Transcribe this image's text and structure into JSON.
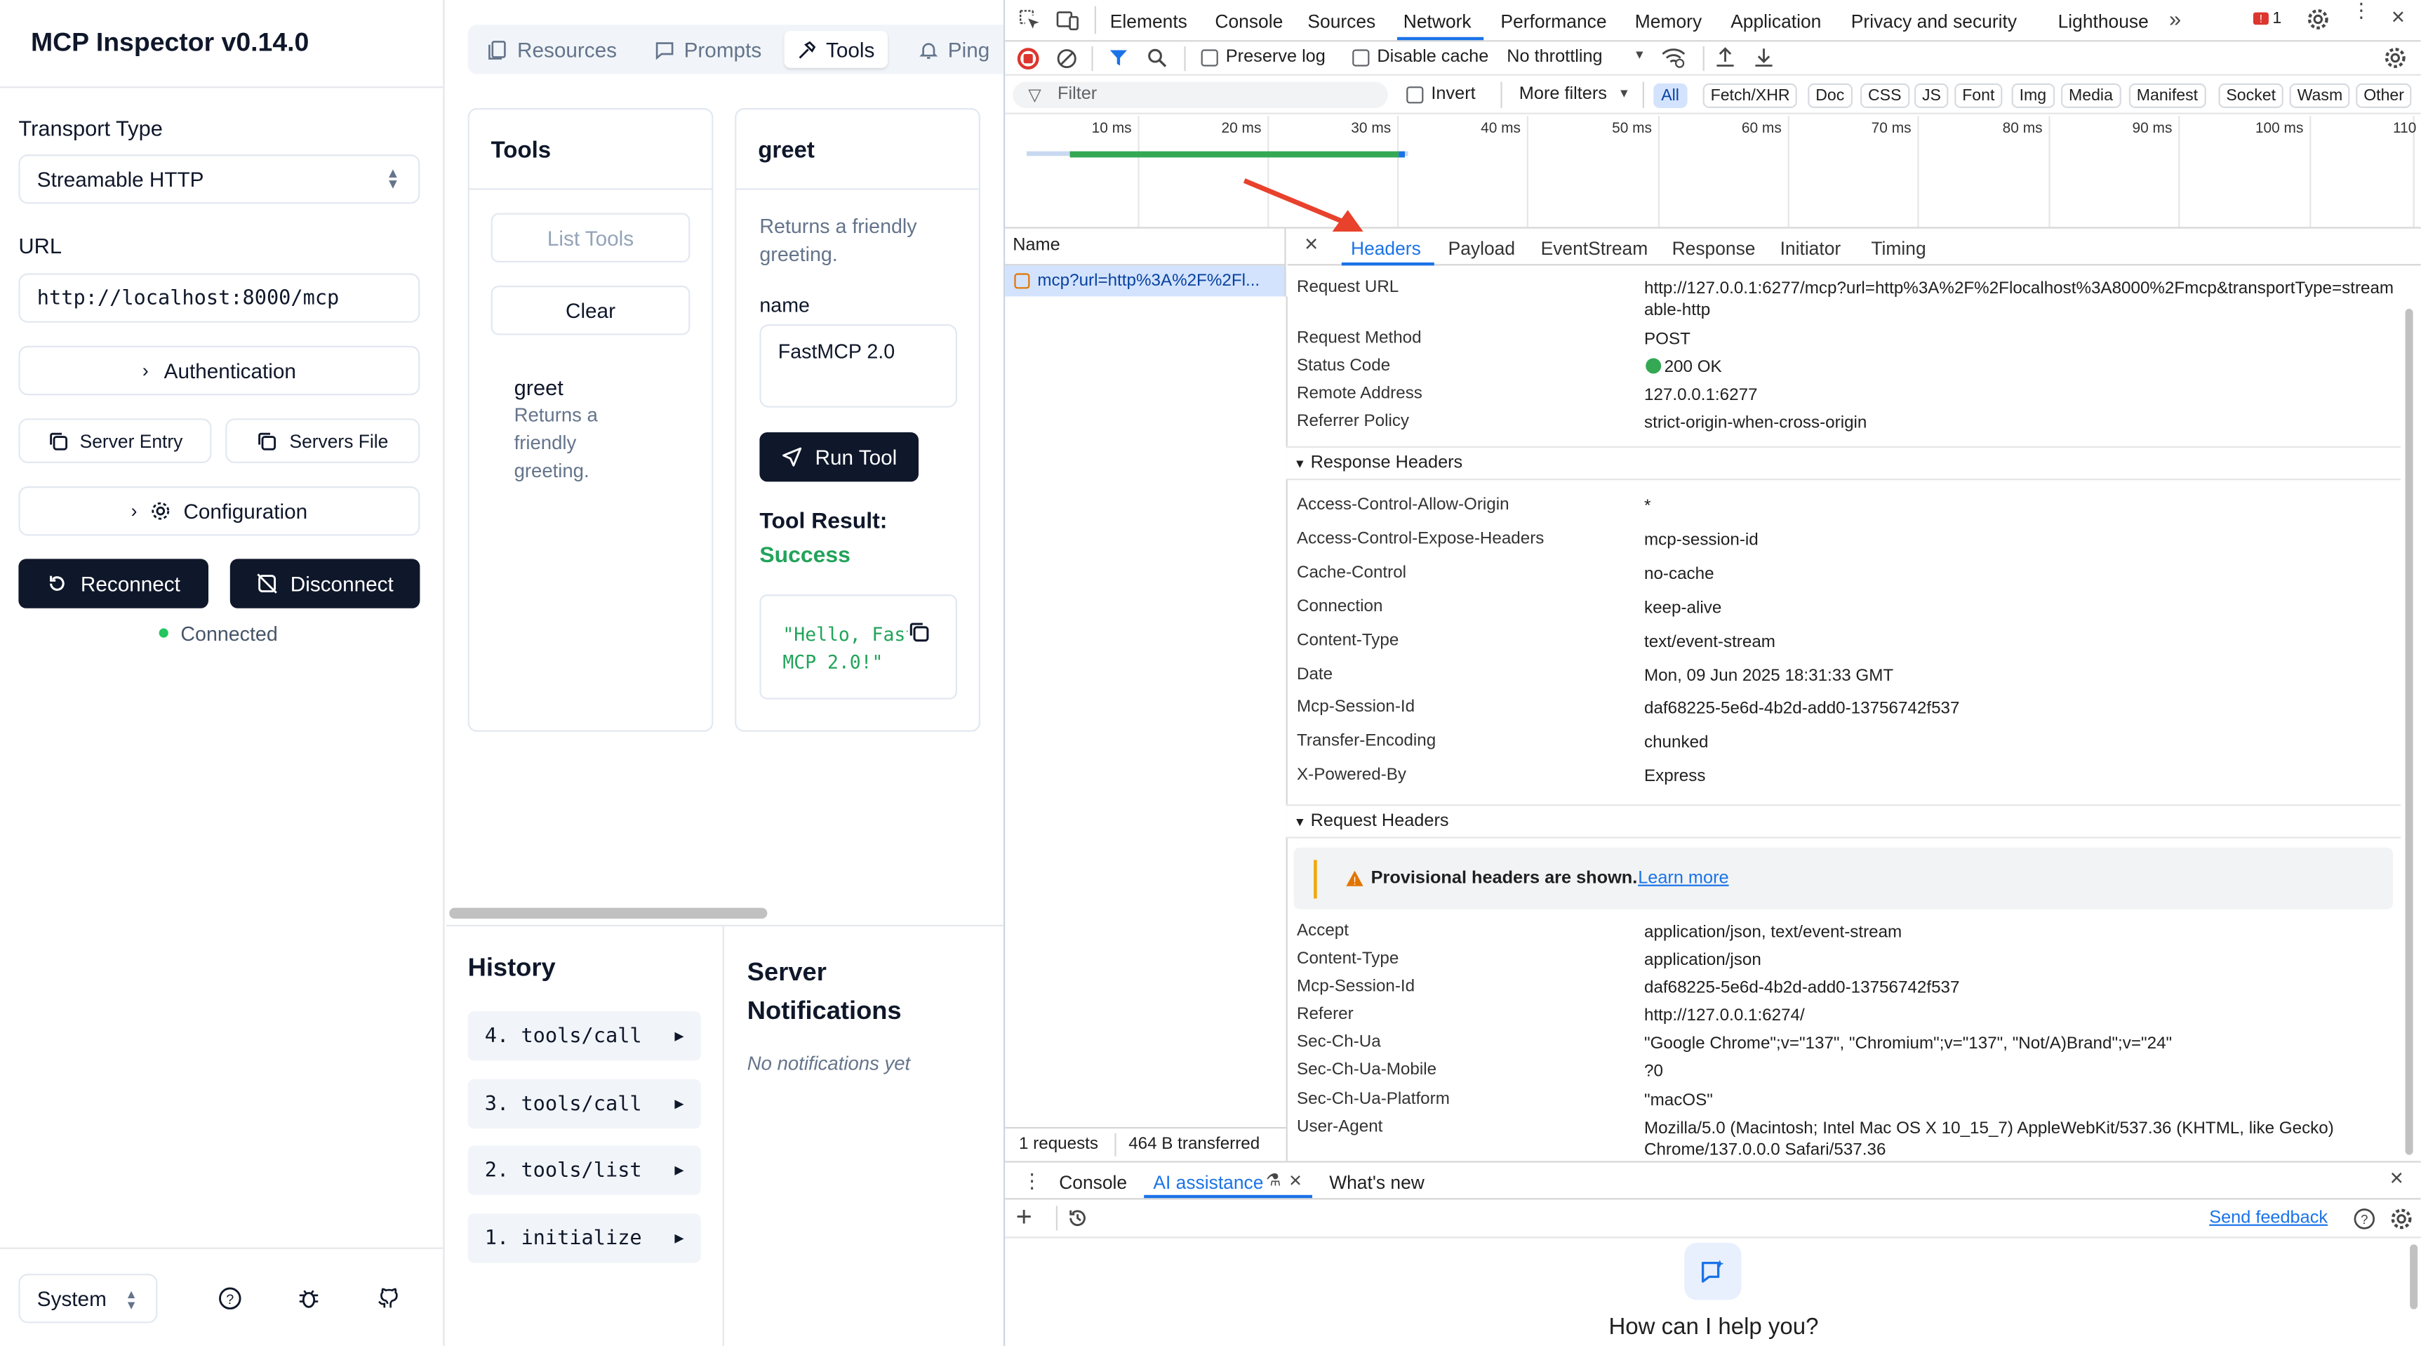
{
  "sidebar": {
    "title": "MCP Inspector v0.14.0",
    "transport_label": "Transport Type",
    "transport_value": "Streamable HTTP",
    "url_label": "URL",
    "url_value": "http://localhost:8000/mcp",
    "authentication": "Authentication",
    "server_entry": "Server Entry",
    "servers_file": "Servers File",
    "configuration": "Configuration",
    "reconnect": "Reconnect",
    "disconnect": "Disconnect",
    "status": "Connected",
    "theme": "System"
  },
  "main": {
    "tabs": [
      "Resources",
      "Prompts",
      "Tools",
      "Ping"
    ],
    "tools_card": {
      "title": "Tools",
      "list_tools": "List Tools",
      "clear": "Clear",
      "tool_name": "greet",
      "tool_desc": "Returns a friendly greeting."
    },
    "greet_card": {
      "title": "greet",
      "desc": "Returns a friendly greeting.",
      "param_label": "name",
      "param_value": "FastMCP 2.0",
      "run": "Run Tool",
      "result_label": "Tool Result:",
      "result_status": "Success",
      "result_text": "\"Hello, FastMCP 2.0!\""
    },
    "history": {
      "title": "History",
      "items": [
        "4. tools/call",
        "3. tools/call",
        "2. tools/list",
        "1. initialize"
      ]
    },
    "notifications": {
      "title": "Server Notifications",
      "empty": "No notifications yet"
    }
  },
  "devtools": {
    "tabs": [
      "Elements",
      "Console",
      "Sources",
      "Network",
      "Performance",
      "Memory",
      "Application",
      "Privacy and security",
      "Lighthouse"
    ],
    "active_tab": "Network",
    "issues_count": "1",
    "toolbar": {
      "preserve_log": "Preserve log",
      "disable_cache": "Disable cache",
      "throttling": "No throttling"
    },
    "filter_placeholder": "Filter",
    "invert": "Invert",
    "more_filters": "More filters",
    "type_filters": [
      "All",
      "Fetch/XHR",
      "Doc",
      "CSS",
      "JS",
      "Font",
      "Img",
      "Media",
      "Manifest",
      "Socket",
      "Wasm",
      "Other"
    ],
    "timeline_ticks": [
      "10 ms",
      "20 ms",
      "30 ms",
      "40 ms",
      "50 ms",
      "60 ms",
      "70 ms",
      "80 ms",
      "90 ms",
      "100 ms",
      "110"
    ],
    "name_header": "Name",
    "request_name": "mcp?url=http%3A%2F%2Fl...",
    "detail_tabs": [
      "Headers",
      "Payload",
      "EventStream",
      "Response",
      "Initiator",
      "Timing"
    ],
    "general": [
      {
        "k": "Request URL",
        "v": "http://127.0.0.1:6277/mcp?url=http%3A%2F%2Flocalhost%3A8000%2Fmcp&transportType=streamable-http"
      },
      {
        "k": "Request Method",
        "v": "POST"
      },
      {
        "k": "Status Code",
        "v": "200 OK"
      },
      {
        "k": "Remote Address",
        "v": "127.0.0.1:6277"
      },
      {
        "k": "Referrer Policy",
        "v": "strict-origin-when-cross-origin"
      }
    ],
    "response_headers_title": "Response Headers",
    "response_headers": [
      {
        "k": "Access-Control-Allow-Origin",
        "v": "*"
      },
      {
        "k": "Access-Control-Expose-Headers",
        "v": "mcp-session-id"
      },
      {
        "k": "Cache-Control",
        "v": "no-cache"
      },
      {
        "k": "Connection",
        "v": "keep-alive"
      },
      {
        "k": "Content-Type",
        "v": "text/event-stream"
      },
      {
        "k": "Date",
        "v": "Mon, 09 Jun 2025 18:31:33 GMT"
      },
      {
        "k": "Mcp-Session-Id",
        "v": "daf68225-5e6d-4b2d-add0-13756742f537"
      },
      {
        "k": "Transfer-Encoding",
        "v": "chunked"
      },
      {
        "k": "X-Powered-By",
        "v": "Express"
      }
    ],
    "request_headers_title": "Request Headers",
    "provisional_text": "Provisional headers are shown.",
    "learn_more": "Learn more",
    "request_headers": [
      {
        "k": "Accept",
        "v": "application/json, text/event-stream"
      },
      {
        "k": "Content-Type",
        "v": "application/json"
      },
      {
        "k": "Mcp-Session-Id",
        "v": "daf68225-5e6d-4b2d-add0-13756742f537"
      },
      {
        "k": "Referer",
        "v": "http://127.0.0.1:6274/"
      },
      {
        "k": "Sec-Ch-Ua",
        "v": "\"Google Chrome\";v=\"137\", \"Chromium\";v=\"137\", \"Not/A)Brand\";v=\"24\""
      },
      {
        "k": "Sec-Ch-Ua-Mobile",
        "v": "?0"
      },
      {
        "k": "Sec-Ch-Ua-Platform",
        "v": "\"macOS\""
      },
      {
        "k": "User-Agent",
        "v": "Mozilla/5.0 (Macintosh; Intel Mac OS X 10_15_7) AppleWebKit/537.36 (KHTML, like Gecko) Chrome/137.0.0.0 Safari/537.36"
      }
    ],
    "status_bar": {
      "requests": "1 requests",
      "transferred": "464 B transferred"
    },
    "drawer_tabs": [
      "Console",
      "AI assistance",
      "What's new"
    ],
    "send_feedback": "Send feedback",
    "ai_prompt": "How can I help you?"
  },
  "colors": {
    "success": "#22a35a",
    "accent_blue": "#1a73e8",
    "dark_button": "#0f172a",
    "annotation_arrow": "#e8412c"
  }
}
